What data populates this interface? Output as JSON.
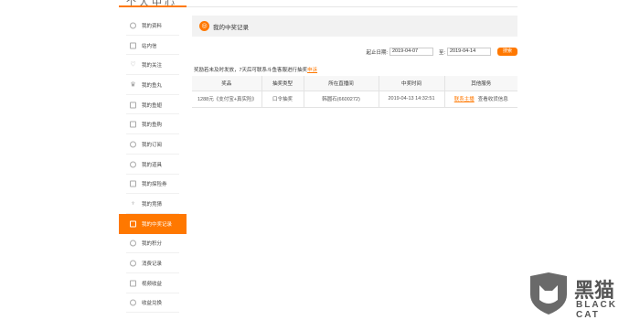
{
  "header": {
    "cut_title": "个人中心"
  },
  "sidebar": {
    "items": [
      {
        "label": "我的资料",
        "icon": "user-icon"
      },
      {
        "label": "站内信",
        "icon": "mail-icon"
      },
      {
        "label": "我的关注",
        "icon": "heart-icon"
      },
      {
        "label": "我的鱼丸",
        "icon": "crown-icon"
      },
      {
        "label": "我的鱼翅",
        "icon": "wallet-icon"
      },
      {
        "label": "我的鱼购",
        "icon": "bag-icon"
      },
      {
        "label": "我的订阅",
        "icon": "bell-icon"
      },
      {
        "label": "我的道具",
        "icon": "gift-icon"
      },
      {
        "label": "我的探险券",
        "icon": "ticket-icon"
      },
      {
        "label": "我的竞猜",
        "icon": "trophy-icon"
      },
      {
        "label": "我的中奖记录",
        "icon": "prize-icon",
        "active": true
      },
      {
        "label": "我的积分",
        "icon": "points-icon"
      },
      {
        "label": "消费记录",
        "icon": "record-icon"
      },
      {
        "label": "视频收益",
        "icon": "video-icon"
      },
      {
        "label": "收益兑换",
        "icon": "exchange-icon"
      }
    ]
  },
  "panel": {
    "title": "我的中奖记录",
    "icon": "prize-icon"
  },
  "filter": {
    "start_label": "起止日期:",
    "start_value": "2019-04-07",
    "to_label": "至:",
    "end_value": "2019-04-14",
    "search_label": "搜索"
  },
  "notice": {
    "text": "奖励若未及时发放，7天后可联系斗鱼客服进行抽奖",
    "link": "申诉"
  },
  "table": {
    "headers": [
      "奖品",
      "抽奖类型",
      "所在直播间",
      "中奖时间",
      "其他服务"
    ],
    "rows": [
      {
        "prize": "1288元《支付宝+真实险》",
        "type": "口令抽奖",
        "room": "韩圆石(6600272)",
        "time": "2019-04-13 14:32:51",
        "service_link": "联系主播",
        "service_text": "查看收货信息"
      }
    ]
  },
  "watermark": {
    "logo_cn": "黑猫",
    "logo_en": "BLACK CAT"
  },
  "colors": {
    "accent": "#ff7800"
  }
}
